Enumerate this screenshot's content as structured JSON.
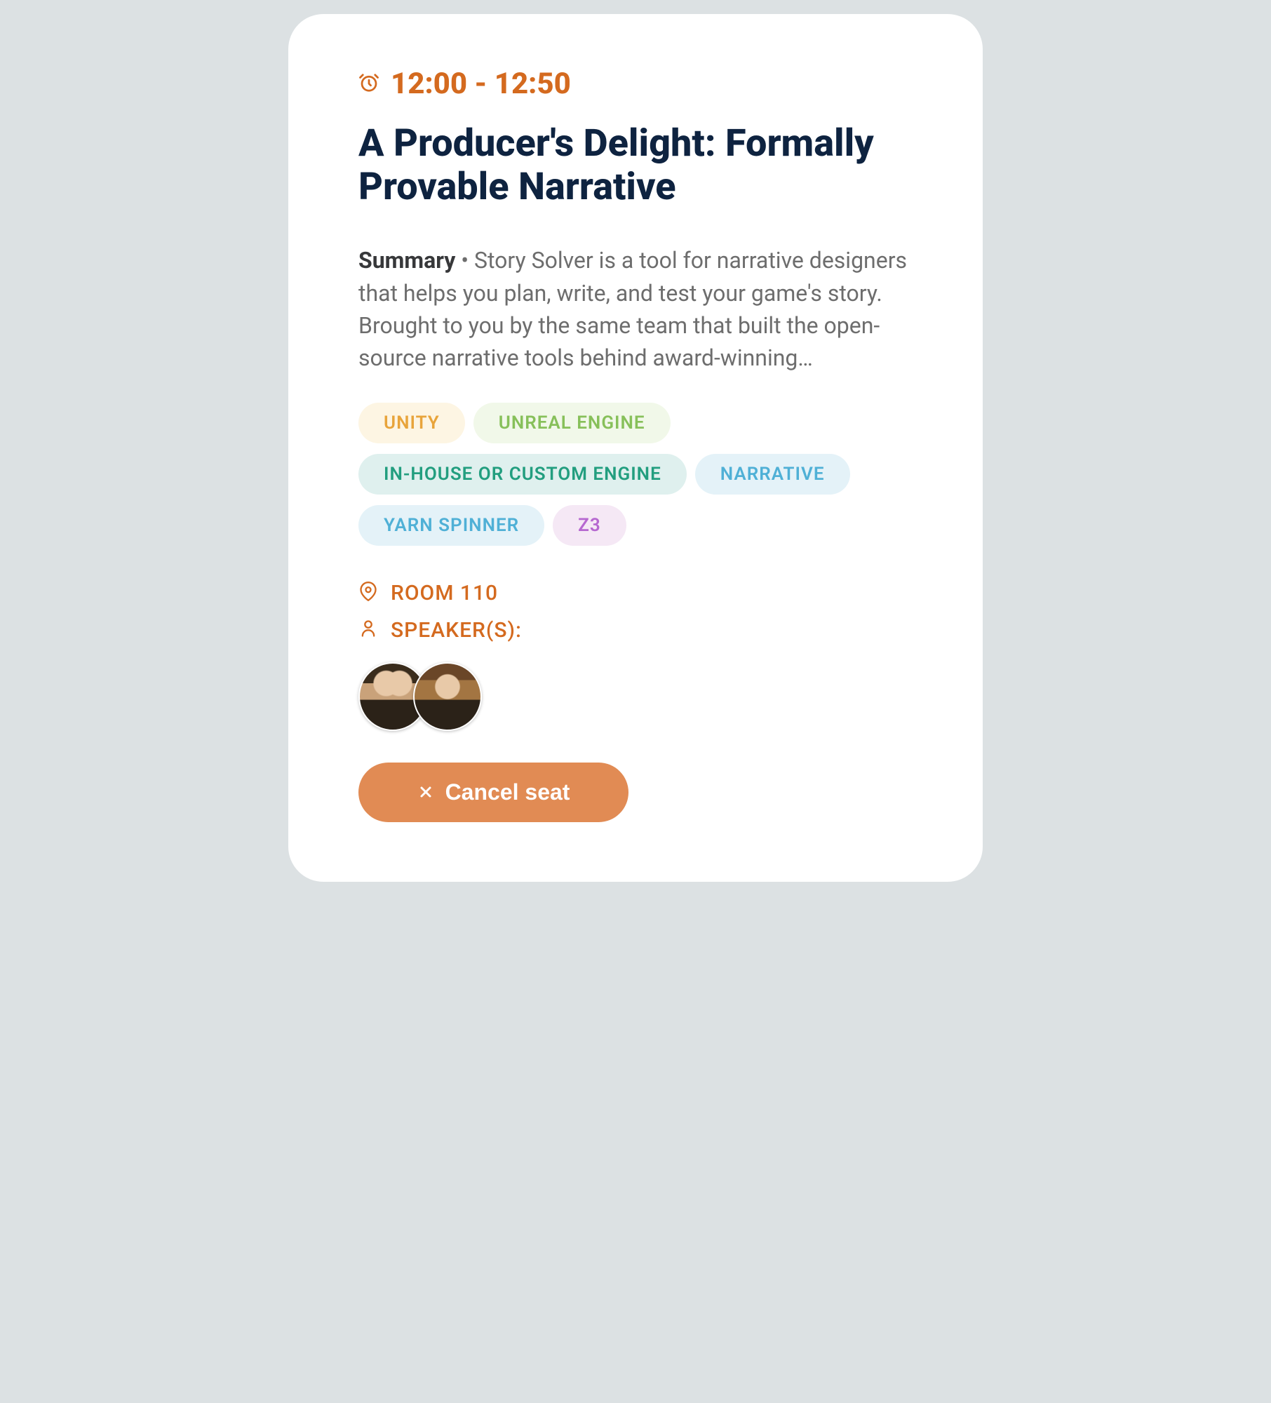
{
  "session": {
    "time": "12:00 - 12:50",
    "title": "A Producer's Delight: Formally Provable Narrative",
    "summary_label": "Summary",
    "summary_text": "Story Solver is a tool for narrative designers that helps you plan, write, and test your game's story. Brought to you by the same team that built the open-source narrative tools behind award-winning…",
    "tags": [
      {
        "label": "UNITY",
        "variant": "unity"
      },
      {
        "label": "UNREAL ENGINE",
        "variant": "unreal"
      },
      {
        "label": "IN-HOUSE OR CUSTOM ENGINE",
        "variant": "inhouse"
      },
      {
        "label": "NARRATIVE",
        "variant": "narrative"
      },
      {
        "label": "YARN SPINNER",
        "variant": "yarn"
      },
      {
        "label": "Z3",
        "variant": "z3"
      }
    ],
    "room": "ROOM 110",
    "speakers_label": "SPEAKER(S):",
    "speaker_count": 2,
    "cancel_button": "Cancel seat"
  },
  "colors": {
    "accent": "#d46a1f",
    "button_bg": "#e18b54",
    "title": "#0e2340"
  }
}
